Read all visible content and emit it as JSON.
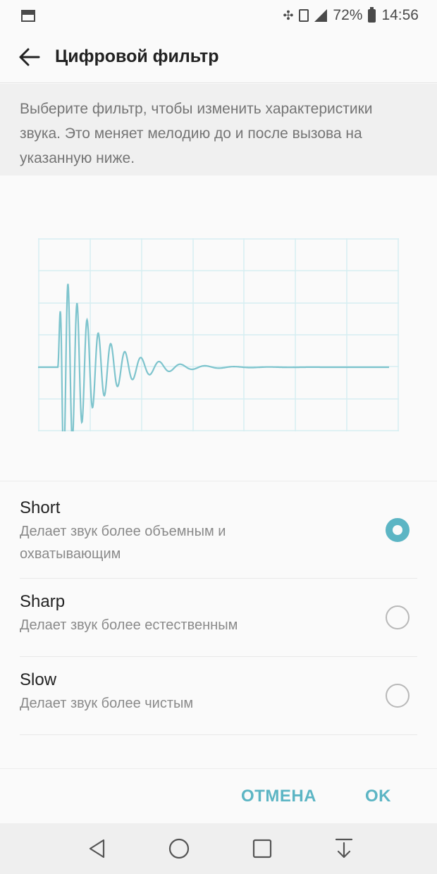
{
  "status_bar": {
    "battery_text": "72%",
    "time": "14:56"
  },
  "app_bar": {
    "title": "Цифровой фильтр"
  },
  "description": "Выберите фильтр, чтобы изменить характеристики звука. Это меняет мелодию до и после вызова на указанную ниже.",
  "options": [
    {
      "title": "Short",
      "description": "Делает звук более объемным и охватывающим",
      "selected": true
    },
    {
      "title": "Sharp",
      "description": "Делает звук более естественным",
      "selected": false
    },
    {
      "title": "Slow",
      "description": "Делает звук более чистым",
      "selected": false
    }
  ],
  "buttons": {
    "cancel": "ОТМЕНА",
    "ok": "OK"
  },
  "colors": {
    "accent": "#5cb5c4",
    "waveform": "#7ec4cd",
    "grid": "#d6eef1"
  },
  "icons": {
    "back": "arrow-left-icon",
    "nav": [
      "triangle-back-icon",
      "circle-home-icon",
      "square-recents-icon",
      "arrow-down-notification-icon"
    ]
  }
}
